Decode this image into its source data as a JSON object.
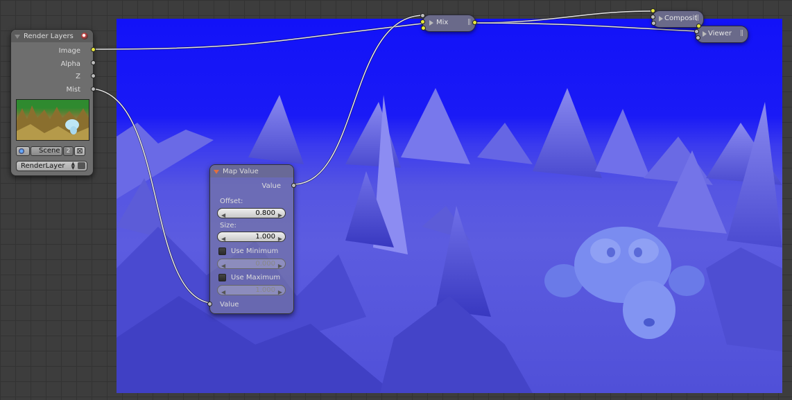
{
  "nodes": {
    "render_layers": {
      "title": "Render Layers",
      "outputs": [
        "Image",
        "Alpha",
        "Z",
        "Mist"
      ],
      "scene": {
        "label": "Scene",
        "users": "2"
      },
      "layer": "RenderLayer"
    },
    "map_value": {
      "title": "Map Value",
      "output_label": "Value",
      "offset_label": "Offset:",
      "offset_value": "0.800",
      "size_label": "Size:",
      "size_value": "1.000",
      "use_min_label": "Use Minimum",
      "min_value": "0.000",
      "use_max_label": "Use Maximum",
      "max_value": "1.000",
      "input_label": "Value"
    },
    "mix": {
      "title": "Mix"
    },
    "composite": {
      "title": "Composit"
    },
    "viewer": {
      "title": "Viewer"
    }
  },
  "colors": {
    "image_socket": "#e8e83a",
    "value_socket": "#bcbcbc",
    "backdrop_sky": "#1212f8",
    "backdrop_ground": "#5c5ce0"
  },
  "icons": {
    "render_layers": "render-layers-icon",
    "scene": "scene-icon",
    "unlink": "close-icon",
    "camera": "camera-icon"
  }
}
